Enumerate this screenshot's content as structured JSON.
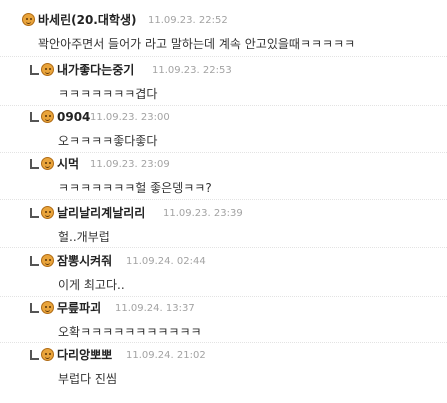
{
  "comments": [
    {
      "author": "바세린(20.대학생)",
      "date": "11.09.23. 22:52",
      "text": "꽉안아주면서 들어가 라고 말하는데 계속 안고있을때ㅋㅋㅋㅋㅋ",
      "reply": false
    },
    {
      "author": "내가좋다는중기",
      "date": "11.09.23. 22:53",
      "text": "ㅋㅋㅋㅋㅋㅋㅋ겹다",
      "reply": true
    },
    {
      "author": "0904",
      "date": "11.09.23. 23:00",
      "text": "오ㅋㅋㅋㅋ좋다좋다",
      "reply": true
    },
    {
      "author": "시먹",
      "date": "11.09.23. 23:09",
      "text": "ㅋㅋㅋㅋㅋㅋㅋ헐 좋은뎅ㅋㅋ?",
      "reply": true
    },
    {
      "author": "날리날리계날리리",
      "date": "11.09.23. 23:39",
      "text": "헐..개부럽",
      "reply": true
    },
    {
      "author": "잠뽕시켜줘",
      "date": "11.09.24. 02:44",
      "text": "이게 최고다..",
      "reply": true
    },
    {
      "author": "무릎파괴",
      "date": "11.09.24. 13:37",
      "text": "오확ㅋㅋㅋㅋㅋㅋㅋㅋㅋㅋㅋ",
      "reply": true
    },
    {
      "author": "다리앙뽀뽀",
      "date": "11.09.24. 21:02",
      "text": "부럽다 진씸",
      "reply": true
    }
  ]
}
